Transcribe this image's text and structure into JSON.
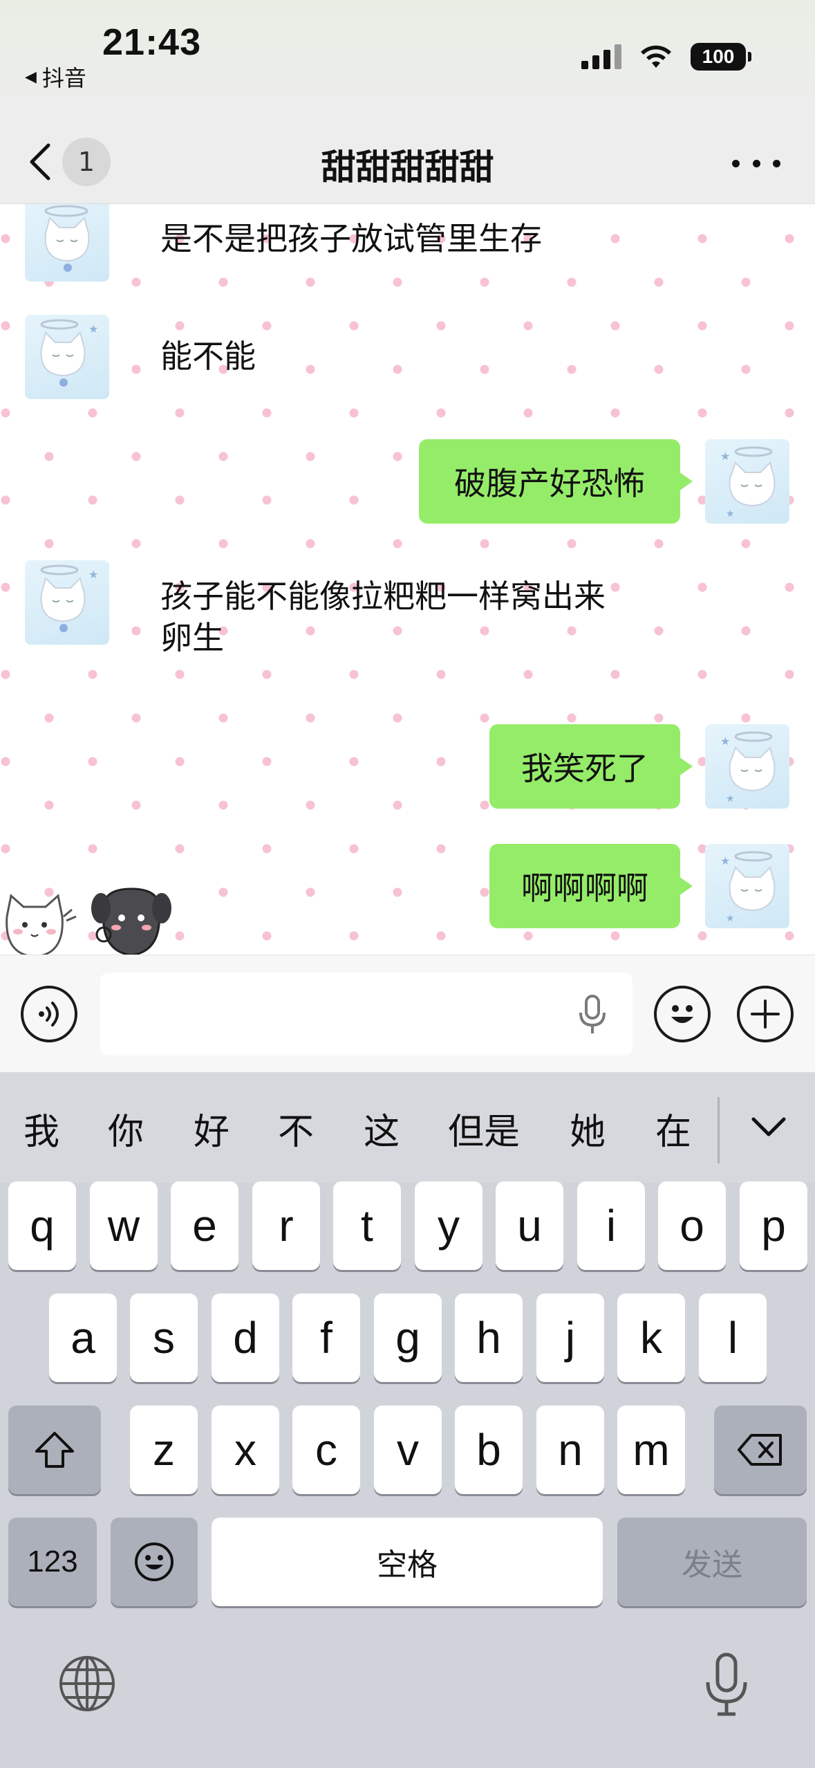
{
  "status_bar": {
    "time": "21:43",
    "back_app": "抖音",
    "battery": "100"
  },
  "nav": {
    "unread_count": "1",
    "title": "甜甜甜甜甜"
  },
  "messages": [
    {
      "side": "left",
      "text": "是不是把孩子放试管里生存"
    },
    {
      "side": "left",
      "text": "能不能"
    },
    {
      "side": "right",
      "text": "破腹产好恐怖"
    },
    {
      "side": "left",
      "text": "孩子能不能像拉粑粑一样窝出来\n卵生"
    },
    {
      "side": "right",
      "text": "我笑死了"
    },
    {
      "side": "right",
      "text": "啊啊啊啊"
    }
  ],
  "input": {
    "value": ""
  },
  "keyboard": {
    "candidates": [
      "我",
      "你",
      "好",
      "不",
      "这",
      "但是",
      "她",
      "在"
    ],
    "row1": [
      "q",
      "w",
      "e",
      "r",
      "t",
      "y",
      "u",
      "i",
      "o",
      "p"
    ],
    "row2": [
      "a",
      "s",
      "d",
      "f",
      "g",
      "h",
      "j",
      "k",
      "l"
    ],
    "row3": [
      "z",
      "x",
      "c",
      "v",
      "b",
      "n",
      "m"
    ],
    "numbers_label": "123",
    "space_label": "空格",
    "send_label": "发送"
  },
  "colors": {
    "bubble_green": "#95ec69",
    "dot_pink": "#f7c2d3"
  }
}
